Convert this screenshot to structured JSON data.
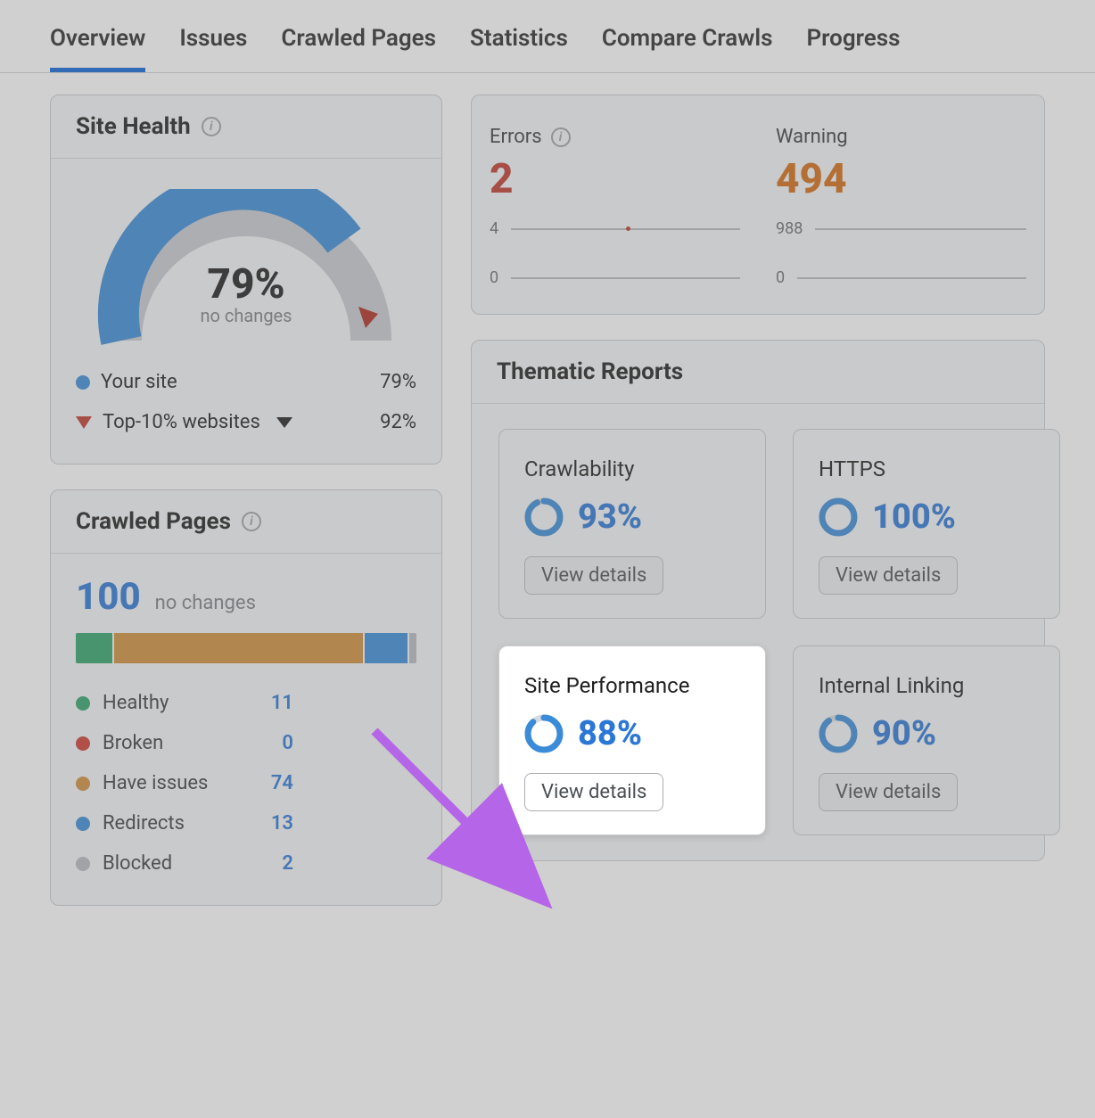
{
  "tabs": {
    "items": [
      "Overview",
      "Issues",
      "Crawled Pages",
      "Statistics",
      "Compare Crawls",
      "Progress"
    ],
    "active_index": 0
  },
  "site_health": {
    "title": "Site Health",
    "percent_label": "79%",
    "subtext": "no changes",
    "legend_your_site": "Your site",
    "legend_your_site_val": "79%",
    "legend_top10": "Top-10% websites",
    "legend_top10_val": "92%"
  },
  "crawled_pages": {
    "title": "Crawled Pages",
    "total": "100",
    "subtext": "no changes",
    "rows": [
      {
        "label": "Healthy",
        "value": "11",
        "color": "#2fa36b"
      },
      {
        "label": "Broken",
        "value": "0",
        "color": "#cf3b2e"
      },
      {
        "label": "Have issues",
        "value": "74",
        "color": "#cf8f3a"
      },
      {
        "label": "Redirects",
        "value": "13",
        "color": "#3a8bd8"
      },
      {
        "label": "Blocked",
        "value": "2",
        "color": "#b7bbc1"
      }
    ]
  },
  "errors": {
    "title": "Errors",
    "value": "2",
    "axis_top": "4",
    "axis_bot": "0"
  },
  "warnings": {
    "title": "Warning",
    "value": "494",
    "axis_top": "988",
    "axis_bot": "0"
  },
  "thematic": {
    "title": "Thematic Reports",
    "view_details": "View details",
    "cards": [
      {
        "name": "Crawlability",
        "pct": "93%",
        "pct_num": 93
      },
      {
        "name": "HTTPS",
        "pct": "100%",
        "pct_num": 100
      },
      {
        "name": "Site Performance",
        "pct": "88%",
        "pct_num": 88,
        "highlight": true
      },
      {
        "name": "Internal Linking",
        "pct": "90%",
        "pct_num": 90
      }
    ]
  },
  "colors": {
    "blue": "#3a8bd8",
    "blue_text": "#2b77d6",
    "grey": "#b7bbc1",
    "red": "#c0392b",
    "orange": "#d46a12"
  },
  "chart_data": [
    {
      "type": "bar",
      "title": "Site Health gauge",
      "categories": [
        "Your site",
        "Top-10% websites"
      ],
      "values": [
        79,
        92
      ],
      "ylim": [
        0,
        100
      ]
    },
    {
      "type": "bar",
      "title": "Crawled Pages breakdown",
      "categories": [
        "Healthy",
        "Broken",
        "Have issues",
        "Redirects",
        "Blocked"
      ],
      "values": [
        11,
        0,
        74,
        13,
        2
      ]
    },
    {
      "type": "line",
      "title": "Errors sparkline",
      "x": [
        0,
        1
      ],
      "series": [
        {
          "name": "Errors",
          "values": [
            2,
            2
          ]
        }
      ],
      "ylim": [
        0,
        4
      ]
    },
    {
      "type": "line",
      "title": "Warnings sparkline",
      "x": [
        0,
        1
      ],
      "series": [
        {
          "name": "Warnings",
          "values": [
            494,
            494
          ]
        }
      ],
      "ylim": [
        0,
        988
      ]
    }
  ]
}
